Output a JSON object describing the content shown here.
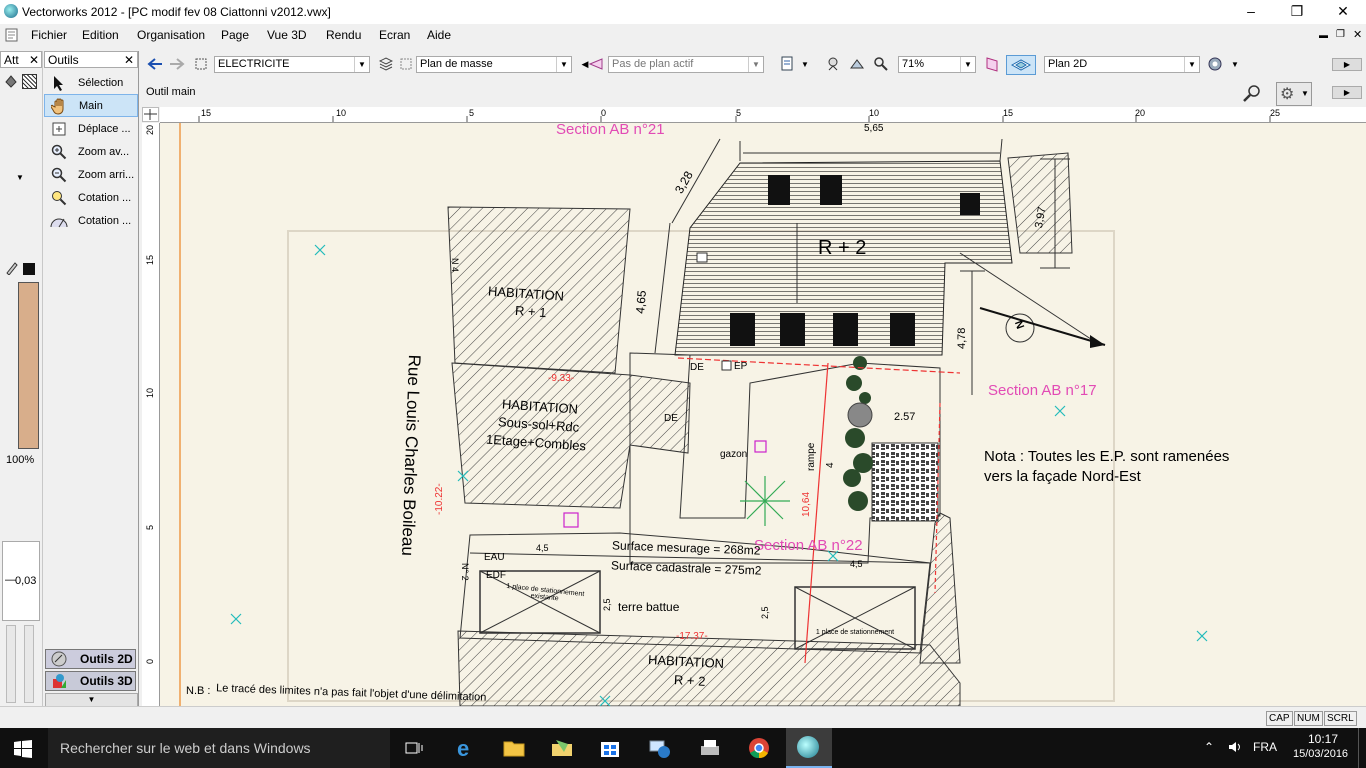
{
  "app": {
    "title": "Vectorworks 2012 - [PC modif fev 08 Ciattonni v2012.vwx]"
  },
  "menu": [
    "Fichier",
    "Edition",
    "Organisation",
    "Page",
    "Vue 3D",
    "Rendu",
    "Ecran",
    "Aide"
  ],
  "attr_palette": {
    "title": "Att",
    "fill_percent": "100%",
    "line_weight": "0,03"
  },
  "tools_palette": {
    "title": "Outils",
    "tools": [
      {
        "label": "Sélection",
        "icon": "arrow-pointer-icon"
      },
      {
        "label": "Main",
        "icon": "hand-icon",
        "selected": true
      },
      {
        "label": "Déplace ...",
        "icon": "move-view-icon"
      },
      {
        "label": "Zoom av...",
        "icon": "zoom-in-icon"
      },
      {
        "label": "Zoom arri...",
        "icon": "zoom-out-icon"
      },
      {
        "label": "Cotation ...",
        "icon": "dimension-icon"
      },
      {
        "label": "Cotation ...",
        "icon": "angular-dimension-icon"
      }
    ],
    "sets": [
      {
        "label": "Outils 2D"
      },
      {
        "label": "Outils 3D"
      }
    ]
  },
  "toolbar": {
    "class_value": "ELECTRICITE",
    "layer_value": "Plan de masse",
    "section_plane_value": "Pas de plan actif",
    "zoom_value": "71%",
    "view_value": "Plan 2D"
  },
  "mode_bar": {
    "tool_name": "Outil main"
  },
  "ruler": {
    "h_labels": [
      "15",
      "10",
      "5",
      "0",
      "5",
      "10",
      "15",
      "20",
      "25"
    ],
    "v_labels": [
      "20",
      "15",
      "10",
      "5",
      "0"
    ]
  },
  "drawing": {
    "labels": {
      "section21": "Section AB n°21",
      "section17": "Section AB n°17",
      "section22": "Section AB n°22",
      "r2": "R + 2",
      "hab1a": "HABITATION",
      "hab1b": "R + 1",
      "hab2a": "HABITATION",
      "hab2b": "Sous-sol+Rdc",
      "hab2c": "1Etage+Combles",
      "street": "Rue Louis Charles Boileau",
      "nota1": "Nota : Toutes les E.P. sont ramenées",
      "nota2": "vers la façade Nord-Est",
      "surf1": "Surface mesurage = 268m2",
      "surf2": "Surface cadastrale = 275m2",
      "terre": "terre battue",
      "gazon": "gazon",
      "rampe": "rampe",
      "hab3a": "HABITATION",
      "hab3b": "R + 2",
      "nb1": "N.B :",
      "nb2": "Le tracé des limites n'a pas fait l'objet d'une délimitation",
      "dim328": "3,28",
      "dim465": "4,65",
      "dim397": "3,97",
      "dim478": "4,78",
      "dim257": "2.57",
      "dim1064": "10,64",
      "dim4": "4",
      "dim45a": "4,5",
      "dim45b": "4,5",
      "dim25a": "2,5",
      "dim25b": "2,5",
      "de1": "DE",
      "de2": "DE",
      "ep": "EP",
      "eau": "EAU",
      "edf": "EDF",
      "n4": "N 4",
      "n2": "N° 2",
      "red1": "-9.33-",
      "red2": "-10.22-",
      "red3": "-17.37-",
      "place1": "1 place de stationnement existante",
      "place2": "1 place de stationnement",
      "dim565": "5,65",
      "north": "N"
    }
  },
  "status": [
    "CAP",
    "NUM",
    "SCRL"
  ],
  "taskbar": {
    "search_placeholder": "Rechercher sur le web et dans Windows",
    "lang": "FRA",
    "time": "10:17",
    "date": "15/03/2016"
  }
}
